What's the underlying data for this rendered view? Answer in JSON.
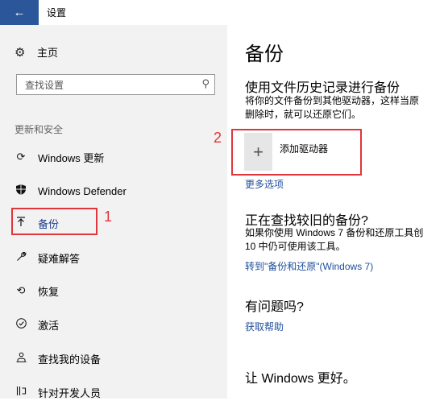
{
  "window": {
    "back_icon": "arrow-left-icon",
    "title": "设置"
  },
  "sidebar": {
    "home_label": "主页",
    "home_icon": "gear-icon",
    "search_placeholder": "查找设置",
    "search_icon": "search-icon",
    "section_header": "更新和安全",
    "items": [
      {
        "label": "Windows 更新",
        "icon": "refresh-icon"
      },
      {
        "label": "Windows Defender",
        "icon": "shield-icon"
      },
      {
        "label": "备份",
        "icon": "upload-icon",
        "selected": true
      },
      {
        "label": "疑难解答",
        "icon": "wrench-icon"
      },
      {
        "label": "恢复",
        "icon": "history-icon"
      },
      {
        "label": "激活",
        "icon": "check-circle-icon"
      },
      {
        "label": "查找我的设备",
        "icon": "person-location-icon"
      },
      {
        "label": "针对开发人员",
        "icon": "developer-icon"
      }
    ]
  },
  "annotations": {
    "step1": "1",
    "step2": "2",
    "color": "#e0353b"
  },
  "main": {
    "title": "备份",
    "file_history": {
      "heading": "使用文件历史记录进行备份",
      "desc_line1": "将你的文件备份到其他驱动器，这样当原",
      "desc_line2": "删除时，就可以还原它们。",
      "add_drive_label": "添加驱动器",
      "add_icon": "plus-icon",
      "more_options": "更多选项"
    },
    "older_backup": {
      "heading": "正在查找较旧的备份?",
      "desc_line1": "如果你使用 Windows 7 备份和还原工具创",
      "desc_line2": "10 中仍可使用该工具。",
      "link": "转到\"备份和还原\"(Windows 7)"
    },
    "help": {
      "heading": "有问题吗?",
      "link": "获取帮助"
    },
    "bottom": {
      "heading": "让 Windows 更好。"
    }
  },
  "colors": {
    "accent": "#2b579a",
    "link": "#1f4e9a",
    "sidebar_bg": "#f2f2f2"
  }
}
